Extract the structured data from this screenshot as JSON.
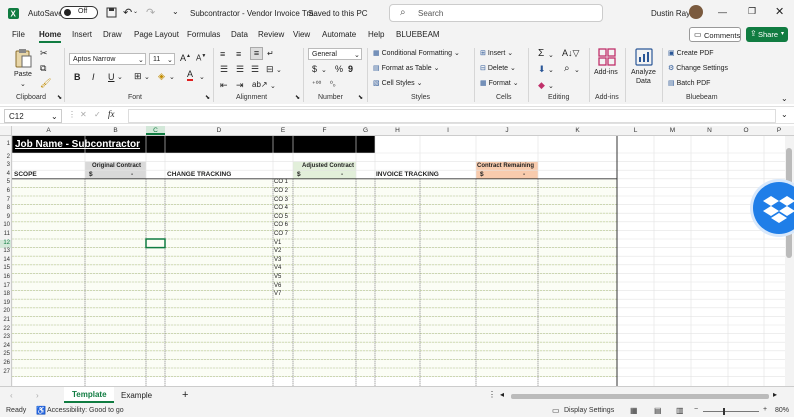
{
  "titlebar": {
    "autosave_label": "AutoSave",
    "autosave_state": "Off",
    "doc_title": "Subcontractor - Vendor Invoice Tra...",
    "save_status": "Saved to this PC",
    "search_placeholder": "Search",
    "user_name": "Dustin Ray"
  },
  "menu": {
    "tabs": [
      "File",
      "Home",
      "Insert",
      "Draw",
      "Page Layout",
      "Formulas",
      "Data",
      "Review",
      "View",
      "Automate",
      "Help",
      "BLUEBEAM"
    ],
    "active": "Home",
    "comments_label": "Comments",
    "share_label": "Share"
  },
  "ribbon": {
    "clipboard": {
      "paste": "Paste",
      "label": "Clipboard"
    },
    "font": {
      "name": "Aptos Narrow",
      "size": "11",
      "label": "Font"
    },
    "alignment": {
      "label": "Alignment"
    },
    "number": {
      "format": "General",
      "label": "Number"
    },
    "styles": {
      "conditional": "Conditional Formatting",
      "table": "Format as Table",
      "cell": "Cell Styles",
      "label": "Styles"
    },
    "cells": {
      "insert": "Insert",
      "delete": "Delete",
      "format": "Format",
      "label": "Cells"
    },
    "editing": {
      "label": "Editing"
    },
    "addins": {
      "btn": "Add-ins",
      "label": "Add-ins"
    },
    "analyze": {
      "btn1": "Analyze",
      "btn2": "Data"
    },
    "bluebeam": {
      "create": "Create PDF",
      "change": "Change Settings",
      "batch": "Batch PDF",
      "label": "Bluebeam"
    }
  },
  "formula": {
    "namebox": "C12",
    "fx": "fx",
    "value": ""
  },
  "columns": [
    "A",
    "B",
    "C",
    "D",
    "E",
    "F",
    "G",
    "H",
    "I",
    "J",
    "K",
    "L",
    "M",
    "N",
    "O",
    "P"
  ],
  "rows": [
    "1",
    "2",
    "3",
    "4",
    "5",
    "6",
    "7",
    "8",
    "9",
    "10",
    "11",
    "12",
    "13",
    "14",
    "15",
    "16",
    "17",
    "18",
    "19",
    "20",
    "21",
    "22",
    "23",
    "24",
    "25",
    "26",
    "27"
  ],
  "sheet": {
    "title": "Job Name - Subcontractor",
    "scope": "SCOPE",
    "original_contract": "Original Contract",
    "dollar": "$",
    "dash": "-",
    "change_tracking": "CHANGE TRACKING",
    "adjusted_contract": "Adjusted Contract",
    "invoice_tracking": "INVOICE TRACKING",
    "contract_remaining": "Contract Remaining",
    "change_orders": [
      "CO 1",
      "CO 2",
      "CO 3",
      "CO 4",
      "CO 5",
      "CO 6",
      "CO 7",
      "V1",
      "V2",
      "V3",
      "V4",
      "V5",
      "V6",
      "V7"
    ]
  },
  "sheettabs": {
    "tabs": [
      "Template",
      "Example"
    ],
    "active": "Template",
    "add": "+"
  },
  "status": {
    "ready": "Ready",
    "accessibility": "Accessibility: Good to go",
    "display": "Display Settings",
    "zoom": "80%"
  },
  "colors": {
    "accent": "#107c41",
    "green_header": "#e2efda",
    "orange_header": "#f8cbad",
    "grey_header": "#d9d9d9",
    "black_title": "#000000"
  }
}
